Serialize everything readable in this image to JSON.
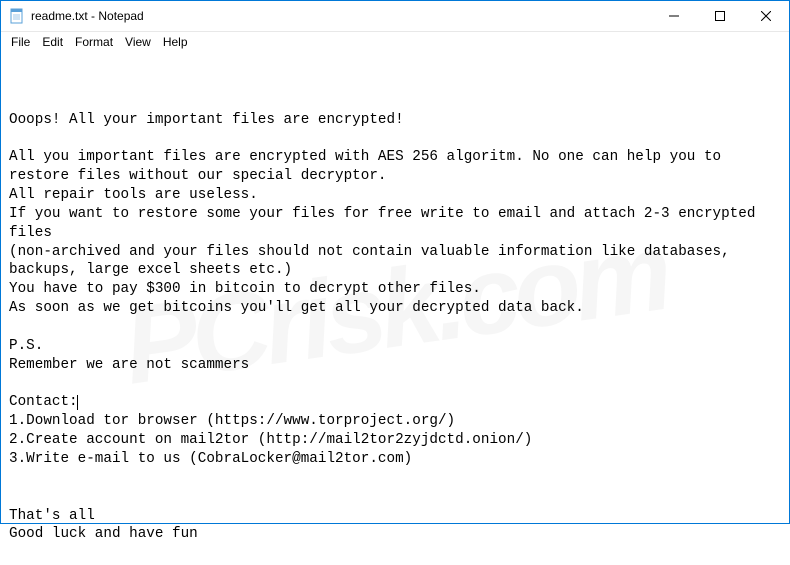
{
  "window": {
    "title": "readme.txt - Notepad"
  },
  "menu": {
    "file": "File",
    "edit": "Edit",
    "format": "Format",
    "view": "View",
    "help": "Help"
  },
  "body": {
    "l1": "Ooops! All your important files are encrypted!",
    "l2": "",
    "l3": "All you important files are encrypted with AES 256 algoritm. No one can help you to restore files without our special decryptor.",
    "l4": "All repair tools are useless.",
    "l5": "If you want to restore some your files for free write to email and attach 2-3 encrypted files",
    "l6": "(non-archived and your files should not contain valuable information like databases, backups, large excel sheets etc.)",
    "l7": "You have to pay $300 in bitcoin to decrypt other files.",
    "l8": "As soon as we get bitcoins you'll get all your decrypted data back.",
    "l9": "",
    "l10": "P.S.",
    "l11": "Remember we are not scammers",
    "l12": "",
    "l13a": "Contact:",
    "l14": "1.Download tor browser (https://www.torproject.org/)",
    "l15": "2.Create account on mail2tor (http://mail2tor2zyjdctd.onion/)",
    "l16": "3.Write e-mail to us (CobraLocker@mail2tor.com)",
    "l17": "",
    "l18": "",
    "l19": "That's all",
    "l20": "Good luck and have fun"
  },
  "watermark": "PCrisk.com"
}
